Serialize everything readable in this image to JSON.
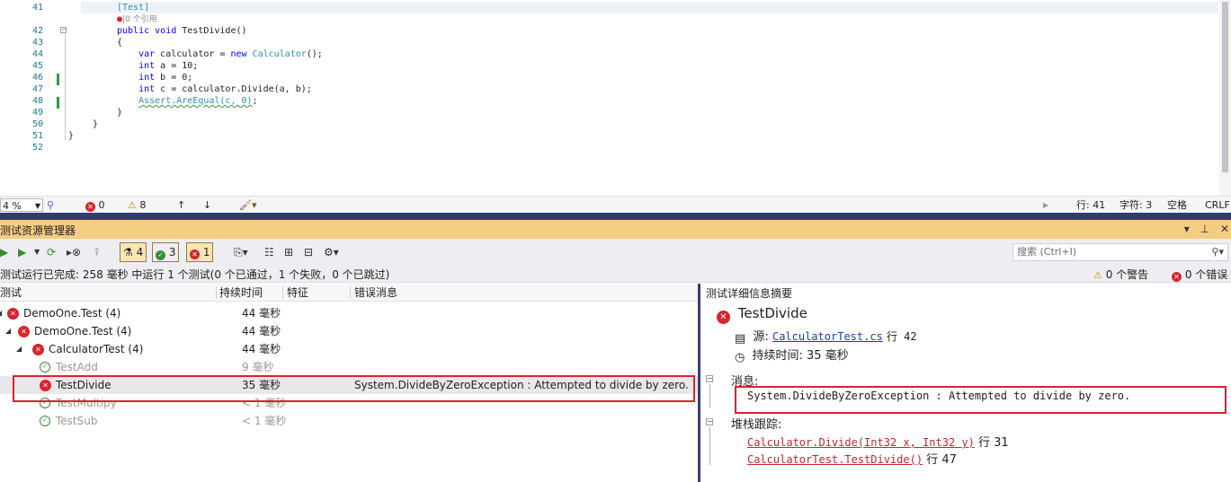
{
  "editor": {
    "lines": [
      {
        "num": "41",
        "html": "<span class=\"attr\">[Test]</span>"
      },
      {
        "num": "",
        "html": "<span style=\"color:#d9232e\">●</span><span class=\"ref\">|0 个引用</span>"
      },
      {
        "num": "42",
        "html": "<span class=\"kw\">public</span> <span class=\"kw\">void</span> TestDivide()"
      },
      {
        "num": "43",
        "html": "{"
      },
      {
        "num": "44",
        "html": "    <span class=\"kw\">var</span> calculator = <span class=\"kw\">new</span> <span class=\"ty\">Calculator</span>();"
      },
      {
        "num": "45",
        "html": "    <span class=\"kw\">int</span> a = 10;"
      },
      {
        "num": "46",
        "html": "    <span class=\"kw\">int</span> b = 0;"
      },
      {
        "num": "47",
        "html": "    <span class=\"kw\">int</span> c = calculator.Divide(a, b);"
      },
      {
        "num": "48",
        "html": "    <span class=\"squig\">Assert.AreEqual(c, 0)</span>;"
      },
      {
        "num": "49",
        "html": "}"
      },
      {
        "num": "50",
        "html": "}"
      },
      {
        "num": "51",
        "html": "}"
      },
      {
        "num": "52",
        "html": ""
      }
    ]
  },
  "status": {
    "zoom": "4 %",
    "errors": "0",
    "warnings": "8",
    "row": "行: 41",
    "col": "字符: 3",
    "spaces": "空格",
    "eol": "CRLF"
  },
  "explorer": {
    "title": "测试资源管理器",
    "title_buttons": [
      "▾",
      "⊥",
      "✕"
    ],
    "counts": {
      "total": "4",
      "passed": "3",
      "failed": "1"
    },
    "search_placeholder": "搜索 (Ctrl+I)",
    "summary": "测试运行已完成: 258 毫秒 中运行 1 个测试(0 个已通过，1 个失败，0 个已跳过)",
    "warnings": "0 个警告",
    "errors": "0 个错误",
    "columns": {
      "test": "测试",
      "duration": "持续时间",
      "traits": "特征",
      "error": "错误消息"
    },
    "rows": [
      {
        "name": "DemoOne.Test (4)",
        "duration": "44 毫秒",
        "msg": "",
        "status": "fail",
        "indent": 0
      },
      {
        "name": "DemoOne.Test (4)",
        "duration": "44 毫秒",
        "msg": "",
        "status": "fail",
        "indent": 1
      },
      {
        "name": "CalculatorTest (4)",
        "duration": "44 毫秒",
        "msg": "",
        "status": "fail",
        "indent": 2
      },
      {
        "name": "TestAdd",
        "duration": "9 毫秒",
        "msg": "",
        "status": "pass",
        "indent": 3
      },
      {
        "name": "TestDivide",
        "duration": "35 毫秒",
        "msg": "System.DivideByZeroException : Attempted to divide by zero.",
        "status": "fail",
        "indent": 3
      },
      {
        "name": "TestMultipy",
        "duration": "< 1 毫秒",
        "msg": "",
        "status": "pass",
        "indent": 3
      },
      {
        "name": "TestSub",
        "duration": "< 1 毫秒",
        "msg": "",
        "status": "pass",
        "indent": 3
      }
    ]
  },
  "detail": {
    "header": "测试详细信息摘要",
    "test_name": "TestDivide",
    "source_label": "源:",
    "source_file": "CalculatorTest.cs",
    "source_line": "行 42",
    "duration_label": "持续时间: 35 毫秒",
    "message_label": "消息:",
    "message": "System.DivideByZeroException : Attempted to divide by zero.",
    "stack_label": "堆栈跟踪:",
    "stack": [
      {
        "frame": "Calculator.Divide(Int32 x, Int32 y)",
        "line": "行 31"
      },
      {
        "frame": "CalculatorTest.TestDivide()",
        "line": "行 47"
      }
    ]
  }
}
